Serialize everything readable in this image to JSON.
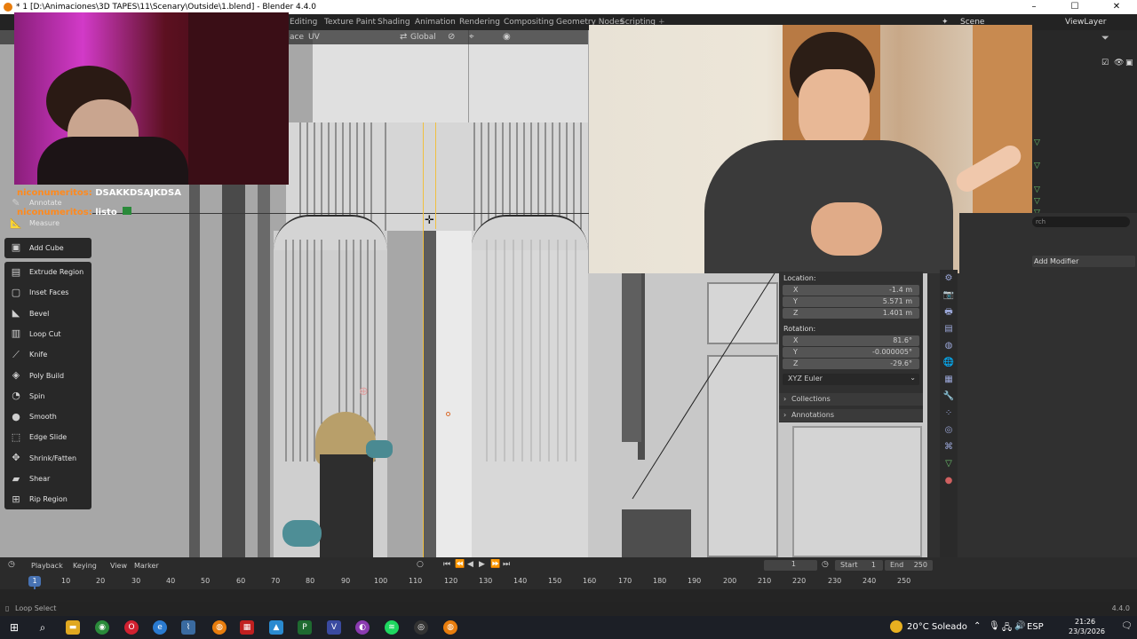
{
  "window": {
    "title": "* 1 [D:\\Animaciones\\3D TAPES\\11\\Scenary\\Outside\\1.blend] - Blender 4.4.0"
  },
  "workspaces": [
    "Editing",
    "Texture Paint",
    "Shading",
    "Animation",
    "Rendering",
    "Compositing",
    "Geometry Nodes",
    "Scripting"
  ],
  "scene": "Scene",
  "view_layer": "ViewLayer",
  "viewport_header": {
    "face_menu": "ace",
    "uv_menu": "UV",
    "transform_orientation": "Global"
  },
  "chat": [
    {
      "user": "niconumeritos:",
      "message": "DSAKKDSAJKDSA"
    },
    {
      "user": "niconumeritos:",
      "message": "listo"
    }
  ],
  "toolbar": {
    "top": [
      {
        "label": "Annotate",
        "icon": "pencil-icon"
      },
      {
        "label": "Measure",
        "icon": "ruler-icon"
      }
    ],
    "add": [
      {
        "label": "Add Cube",
        "icon": "cube-add-icon"
      }
    ],
    "edit": [
      {
        "label": "Extrude Region",
        "icon": "extrude-icon"
      },
      {
        "label": "Inset Faces",
        "icon": "inset-icon"
      },
      {
        "label": "Bevel",
        "icon": "bevel-icon"
      },
      {
        "label": "Loop Cut",
        "icon": "loop-cut-icon"
      },
      {
        "label": "Knife",
        "icon": "knife-icon"
      },
      {
        "label": "Poly Build",
        "icon": "poly-build-icon"
      },
      {
        "label": "Spin",
        "icon": "spin-icon"
      },
      {
        "label": "Smooth",
        "icon": "smooth-icon"
      },
      {
        "label": "Edge Slide",
        "icon": "edge-slide-icon"
      },
      {
        "label": "Shrink/Fatten",
        "icon": "shrink-fatten-icon"
      },
      {
        "label": "Shear",
        "icon": "shear-icon"
      },
      {
        "label": "Rip Region",
        "icon": "rip-region-icon"
      }
    ]
  },
  "transform": {
    "location_label": "Location:",
    "location": [
      {
        "axis": "X",
        "value": "-1.4 m"
      },
      {
        "axis": "Y",
        "value": "5.571 m"
      },
      {
        "axis": "Z",
        "value": "1.401 m"
      }
    ],
    "rotation_label": "Rotation:",
    "rotation": [
      {
        "axis": "X",
        "value": "81.6°"
      },
      {
        "axis": "Y",
        "value": "-0.000005°"
      },
      {
        "axis": "Z",
        "value": "-29.6°"
      }
    ],
    "rotation_mode": "XYZ Euler",
    "collections": "Collections",
    "annotations": "Annotations"
  },
  "properties": {
    "add_modifier": "Add Modifier",
    "search_placeholder": "rch"
  },
  "timeline": {
    "menus": [
      "Playback",
      "Keying",
      "View",
      "Marker"
    ],
    "current_frame": "1",
    "start_label": "Start",
    "start": "1",
    "end_label": "End",
    "end": "250",
    "ruler": [
      "10",
      "20",
      "30",
      "40",
      "50",
      "60",
      "70",
      "80",
      "90",
      "100",
      "110",
      "120",
      "130",
      "140",
      "150",
      "160",
      "170",
      "180",
      "190",
      "200",
      "210",
      "220",
      "230",
      "240",
      "250"
    ],
    "frame_marker": "1"
  },
  "status": {
    "left": "Loop Select",
    "version": "4.4.0"
  },
  "taskbar": {
    "weather": "20°C Soleado",
    "lang": "ESP",
    "time": "21:26",
    "date": "23/3/2026"
  },
  "colors": {
    "accent": "#e87d0d",
    "frame_marker": "#4772b3",
    "chat_name": "#ff8a1e"
  }
}
